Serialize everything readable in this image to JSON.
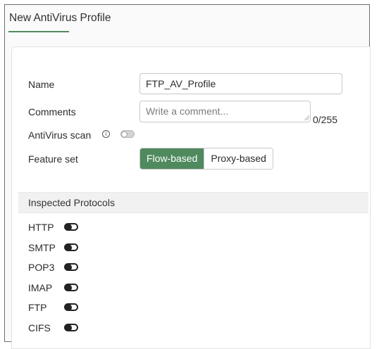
{
  "page": {
    "title": "New AntiVirus Profile"
  },
  "form": {
    "name_label": "Name",
    "name_value": "FTP_AV_Profile",
    "comments_label": "Comments",
    "comments_placeholder": "Write a comment...",
    "comments_counter": "0/255",
    "antivirus_scan_label": "AntiVirus scan",
    "antivirus_scan_info_glyph": "i",
    "antivirus_scan_enabled": false,
    "feature_set_label": "Feature set",
    "feature_set_options": [
      "Flow-based",
      "Proxy-based"
    ],
    "feature_set_selected": "Flow-based"
  },
  "inspected_protocols": {
    "title": "Inspected Protocols",
    "items": [
      {
        "label": "HTTP",
        "enabled": false
      },
      {
        "label": "SMTP",
        "enabled": false
      },
      {
        "label": "POP3",
        "enabled": false
      },
      {
        "label": "IMAP",
        "enabled": false
      },
      {
        "label": "FTP",
        "enabled": false
      },
      {
        "label": "CIFS",
        "enabled": false
      }
    ]
  },
  "colors": {
    "accent": "#4f8a5f"
  },
  "icons": {
    "info": "info-icon",
    "resize": "resize-grip-icon"
  }
}
